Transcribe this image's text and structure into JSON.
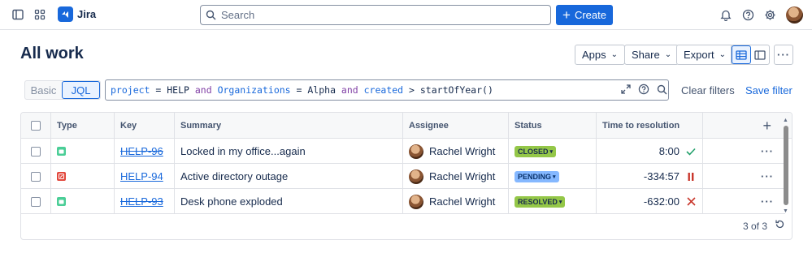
{
  "nav": {
    "app_name": "Jira",
    "search_placeholder": "Search",
    "create_label": "Create"
  },
  "header": {
    "title": "All work",
    "apps_label": "Apps",
    "share_label": "Share",
    "export_label": "Export"
  },
  "jql_bar": {
    "basic_label": "Basic",
    "jql_label": "JQL",
    "tokens": [
      {
        "text": "project",
        "kind": "kf"
      },
      {
        "text": " = ",
        "kind": "tx"
      },
      {
        "text": "HELP",
        "kind": "tx"
      },
      {
        "text": " and ",
        "kind": "kw"
      },
      {
        "text": "Organizations",
        "kind": "kf"
      },
      {
        "text": " = ",
        "kind": "tx"
      },
      {
        "text": "Alpha",
        "kind": "tx"
      },
      {
        "text": " and ",
        "kind": "kw"
      },
      {
        "text": "created",
        "kind": "kf"
      },
      {
        "text": " > ",
        "kind": "tx"
      },
      {
        "text": "startOfYear()",
        "kind": "tx"
      }
    ],
    "clear_filters_label": "Clear filters",
    "save_filter_label": "Save filter"
  },
  "table": {
    "columns": [
      "Type",
      "Key",
      "Summary",
      "Assignee",
      "Status",
      "Time to resolution"
    ],
    "rows": [
      {
        "type_icon": "service-request-icon",
        "type_color": "#4bce97",
        "key": "HELP-96",
        "resolved": true,
        "summary": "Locked in my office...again",
        "assignee": "Rachel Wright",
        "status": "CLOSED",
        "status_bg": "#94c748",
        "status_fg": "#172b4d",
        "ttr": "8:00",
        "ttr_icon": "check-icon",
        "ttr_color": "#22a06b"
      },
      {
        "type_icon": "incident-icon",
        "type_color": "#e2483d",
        "key": "HELP-94",
        "resolved": false,
        "summary": "Active directory outage",
        "assignee": "Rachel Wright",
        "status": "PENDING",
        "status_bg": "#85b8ff",
        "status_fg": "#09326c",
        "ttr": "-334:57",
        "ttr_icon": "pause-icon",
        "ttr_color": "#c9372c"
      },
      {
        "type_icon": "service-request-icon",
        "type_color": "#4bce97",
        "key": "HELP-93",
        "resolved": true,
        "summary": "Desk phone exploded",
        "assignee": "Rachel Wright",
        "status": "RESOLVED",
        "status_bg": "#94c748",
        "status_fg": "#172b4d",
        "ttr": "-632:00",
        "ttr_icon": "x-icon",
        "ttr_color": "#c9372c"
      }
    ],
    "count_label": "3 of 3"
  }
}
